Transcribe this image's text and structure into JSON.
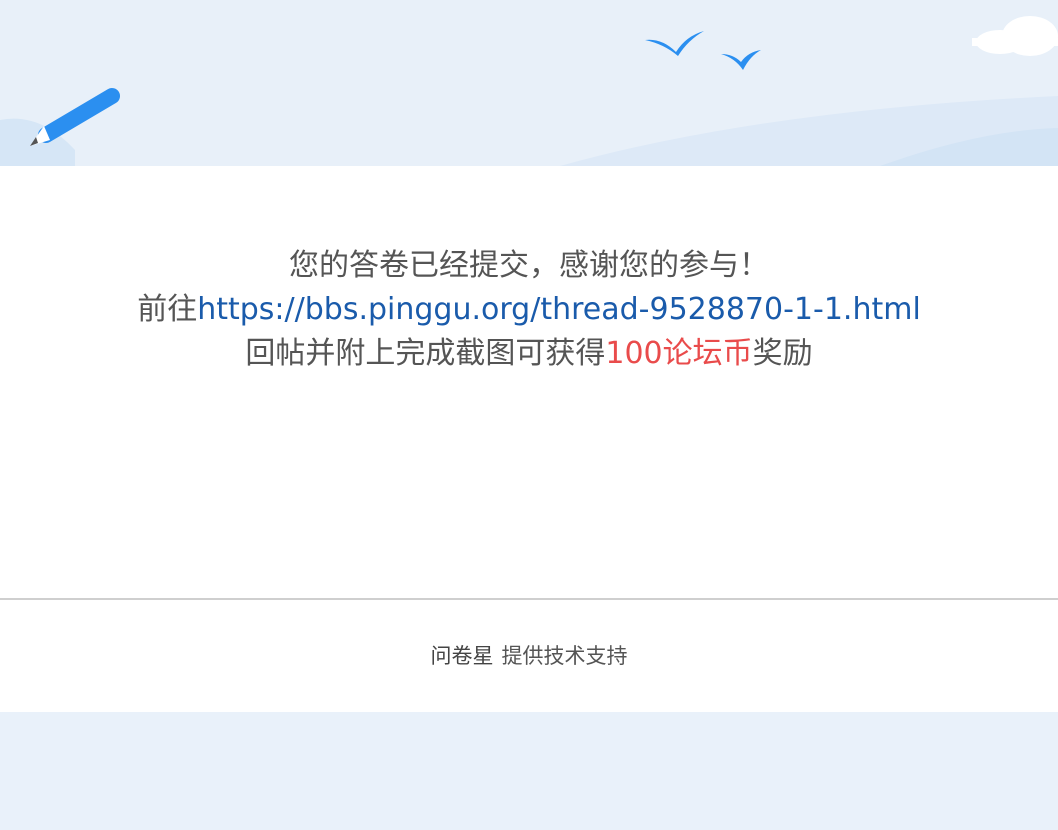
{
  "banner": {
    "icons": [
      "pencil-icon",
      "bird-icon",
      "bird-icon",
      "cloud-icon"
    ],
    "colors": {
      "sky": "#e8f0f9",
      "hill": "#d6e6f6",
      "pencil": "#2b8ff0",
      "bird": "#2b8ff0",
      "cloud": "#ffffff"
    }
  },
  "message": {
    "line1": "您的答卷已经提交，感谢您的参与！",
    "line2_prefix": "前往",
    "line2_link": "https://bbs.pinggu.org/thread-9528870-1-1.html",
    "line3_prefix": "回帖并附上完成截图可获得",
    "line3_reward": "100论坛币",
    "line3_suffix": "奖励"
  },
  "footer": {
    "brand": "问卷星",
    "support": "提供技术支持"
  },
  "colors": {
    "text": "#555555",
    "link": "#1a5bab",
    "reward": "#e94b4b",
    "divider": "#cfcfcf",
    "page_background": "#e9f1fa"
  }
}
